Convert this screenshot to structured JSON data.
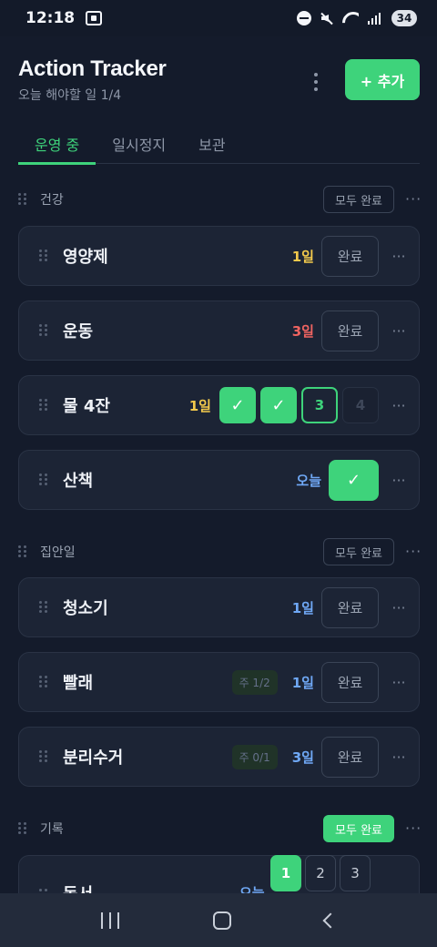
{
  "status": {
    "time": "12:18",
    "battery": "34"
  },
  "header": {
    "title": "Action Tracker",
    "subtitle": "오늘 해야할 일 1/4",
    "add_label": "+ 추가"
  },
  "tabs": [
    {
      "label": "운영 중",
      "active": true
    },
    {
      "label": "일시정지",
      "active": false
    },
    {
      "label": "보관",
      "active": false
    }
  ],
  "sections": [
    {
      "label": "건강",
      "all_done": "모두 완료",
      "items": [
        {
          "title": "영양제",
          "streak": "1일",
          "action": "완료"
        },
        {
          "title": "운동",
          "streak": "3일",
          "action": "완료"
        },
        {
          "title": "물 4잔",
          "streak": "1일",
          "steps": [
            "✓",
            "✓",
            "3",
            "4"
          ]
        },
        {
          "title": "산책",
          "streak": "오늘",
          "check": "✓"
        }
      ]
    },
    {
      "label": "집안일",
      "all_done": "모두 완료",
      "items": [
        {
          "title": "청소기",
          "streak": "1일",
          "action": "완료"
        },
        {
          "title": "빨래",
          "badge": "주 1/2",
          "streak": "1일",
          "action": "완료"
        },
        {
          "title": "분리수거",
          "badge": "주 0/1",
          "streak": "3일",
          "action": "완료"
        }
      ]
    },
    {
      "label": "기록",
      "all_done": "모두 완료",
      "items": [
        {
          "title": "독서",
          "streak": "오늘",
          "steps": [
            "1",
            "2",
            "3"
          ]
        }
      ]
    }
  ],
  "more_glyph": "···"
}
